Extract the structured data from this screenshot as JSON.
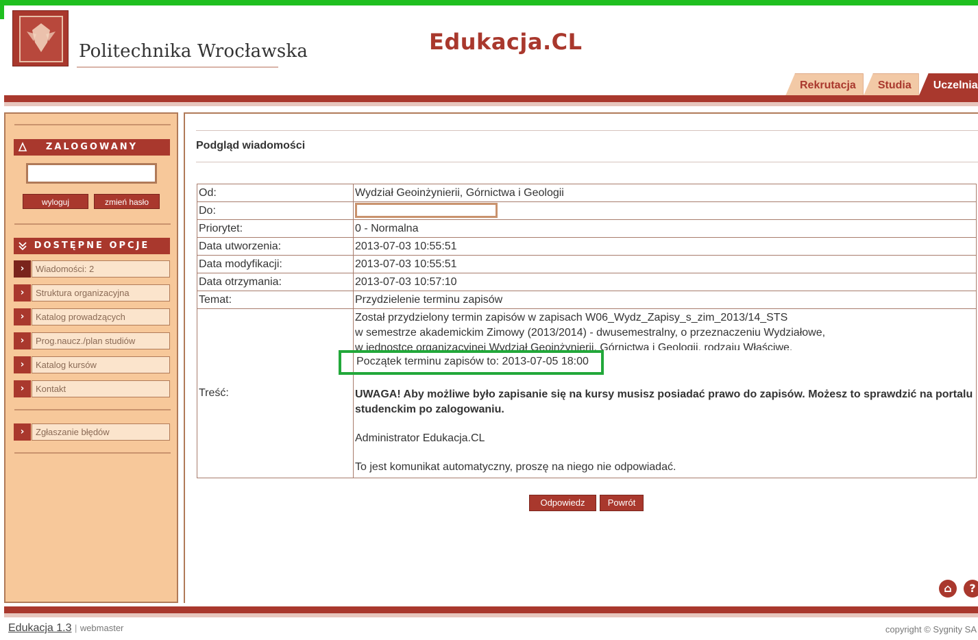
{
  "header": {
    "university_name": "Politechnika Wrocławska",
    "app_title": "Edukacja.CL",
    "tabs": [
      {
        "label": "Rekrutacja",
        "active": false
      },
      {
        "label": "Studia",
        "active": false
      },
      {
        "label": "Uczelnia",
        "active": true
      }
    ]
  },
  "sidebar": {
    "logged_header": "ZALOGOWANY",
    "login_field_value": "",
    "logout_label": "wyloguj",
    "change_password_label": "zmień hasło",
    "options_header": "DOSTĘPNE OPCJE",
    "menu": [
      {
        "label": "Wiadomości: 2"
      },
      {
        "label": "Struktura organizacyjna"
      },
      {
        "label": "Katalog prowadzących"
      },
      {
        "label": "Prog.naucz./plan studiów"
      },
      {
        "label": "Katalog kursów"
      },
      {
        "label": "Kontakt"
      }
    ],
    "report_label": "Zgłaszanie błędów"
  },
  "main": {
    "heading": "Podgląd wiadomości",
    "rows": [
      {
        "label": "Od:",
        "value": "Wydział Geoinżynierii, Górnictwa i Geologii"
      },
      {
        "label": "Do:",
        "value": ""
      },
      {
        "label": "Priorytet:",
        "value": "0 - Normalna"
      },
      {
        "label": "Data utworzenia:",
        "value": "2013-07-03 10:55:51"
      },
      {
        "label": "Data modyfikacji:",
        "value": "2013-07-03 10:55:51"
      },
      {
        "label": "Data otrzymania:",
        "value": "2013-07-03 10:57:10"
      },
      {
        "label": "Temat:",
        "value": "Przydzielenie terminu zapisów"
      }
    ],
    "body_label": "Treść:",
    "body": {
      "line1": "Został przydzielony termin zapisów w zapisach W06_Wydz_Zapisy_s_zim_2013/14_STS",
      "line2": "w semestrze akademickim Zimowy (2013/2014) - dwusemestralny, o przeznaczeniu Wydziałowe,",
      "line3": "w jednostce organizacyjnej Wydział Geoinżynierii, Górnictwa i Geologii, rodzaju Właściwe.",
      "highlight": "Początek terminu zapisów to: 2013-07-05 18:00",
      "warning": "UWAGA! Aby możliwe było zapisanie się na kursy musisz posiadać prawo do zapisów. Możesz to sprawdzić na portalu studenckim po zalogowaniu.",
      "admin": "Administrator Edukacja.CL",
      "auto": "To jest komunikat automatyczny, proszę na niego nie odpowiadać."
    },
    "reply_label": "Odpowiedz",
    "back_label": "Powrót"
  },
  "footer": {
    "version": "Edukacja 1.3",
    "separator": "|",
    "webmaster": "webmaster",
    "copyright": "copyright © Sygnity SA"
  },
  "colors": {
    "brand": "#a9382d",
    "sidebar_bg": "#f7c89a",
    "highlight_border": "#22a83a",
    "top_bar": "#1fbf1f"
  },
  "icons": {
    "home": "home-icon",
    "help": "help-icon"
  }
}
